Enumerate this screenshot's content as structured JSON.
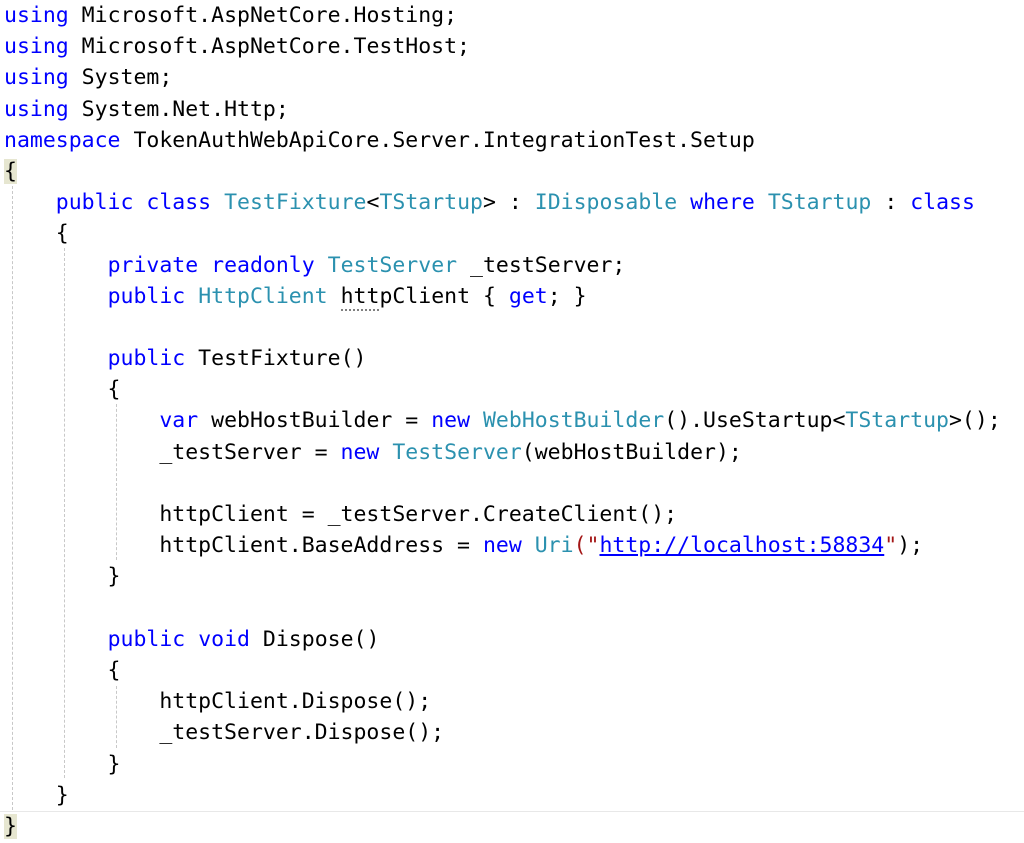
{
  "editor": {
    "language": "C#",
    "colors": {
      "keyword": "#0000ff",
      "type": "#2b91af",
      "identifier": "#000000",
      "string": "#a31515",
      "url": "#0000ff"
    },
    "lines": [
      [
        [
          "kw",
          "using"
        ],
        [
          "tx",
          " Microsoft.AspNetCore.Hosting;"
        ]
      ],
      [
        [
          "kw",
          "using"
        ],
        [
          "tx",
          " Microsoft.AspNetCore.TestHost;"
        ]
      ],
      [
        [
          "kw",
          "using"
        ],
        [
          "tx",
          " System;"
        ]
      ],
      [
        [
          "kw",
          "using"
        ],
        [
          "tx",
          " System.Net.Http;"
        ]
      ],
      [
        [
          "kw",
          "namespace"
        ],
        [
          "tx",
          " TokenAuthWebApiCore.Server.IntegrationTest.Setup"
        ]
      ],
      [
        [
          "brace",
          "{"
        ]
      ],
      [
        [
          "tx",
          "    "
        ],
        [
          "kw",
          "public"
        ],
        [
          "tx",
          " "
        ],
        [
          "kw",
          "class"
        ],
        [
          "tx",
          " "
        ],
        [
          "ty",
          "TestFixture"
        ],
        [
          "tx",
          "<"
        ],
        [
          "ty",
          "TStartup"
        ],
        [
          "tx",
          "> : "
        ],
        [
          "ty",
          "IDisposable"
        ],
        [
          "tx",
          " "
        ],
        [
          "kw",
          "where"
        ],
        [
          "tx",
          " "
        ],
        [
          "ty",
          "TStartup"
        ],
        [
          "tx",
          " : "
        ],
        [
          "kw",
          "class"
        ]
      ],
      [
        [
          "tx",
          "    {"
        ]
      ],
      [
        [
          "tx",
          "        "
        ],
        [
          "kw",
          "private"
        ],
        [
          "tx",
          " "
        ],
        [
          "kw",
          "readonly"
        ],
        [
          "tx",
          " "
        ],
        [
          "ty",
          "TestServer"
        ],
        [
          "tx",
          " _testServer;"
        ]
      ],
      [
        [
          "tx",
          "        "
        ],
        [
          "kw",
          "public"
        ],
        [
          "tx",
          " "
        ],
        [
          "ty",
          "HttpClient"
        ],
        [
          "tx",
          " "
        ],
        [
          "sq",
          "htt"
        ],
        [
          "tx",
          "pClient { "
        ],
        [
          "kw",
          "get"
        ],
        [
          "tx",
          "; }"
        ]
      ],
      [
        [
          "tx",
          ""
        ]
      ],
      [
        [
          "tx",
          "        "
        ],
        [
          "kw",
          "public"
        ],
        [
          "tx",
          " TestFixture()"
        ]
      ],
      [
        [
          "tx",
          "        {"
        ]
      ],
      [
        [
          "tx",
          "            "
        ],
        [
          "kw",
          "var"
        ],
        [
          "tx",
          " webHostBuilder = "
        ],
        [
          "kw",
          "new"
        ],
        [
          "tx",
          " "
        ],
        [
          "ty",
          "WebHostBuilder"
        ],
        [
          "tx",
          "().UseStartup<"
        ],
        [
          "ty",
          "TStartup"
        ],
        [
          "tx",
          ">();"
        ]
      ],
      [
        [
          "tx",
          "            _testServer = "
        ],
        [
          "kw",
          "new"
        ],
        [
          "tx",
          " "
        ],
        [
          "ty",
          "TestServer"
        ],
        [
          "tx",
          "(webHostBuilder);"
        ]
      ],
      [
        [
          "tx",
          ""
        ]
      ],
      [
        [
          "tx",
          "            httpClient = _testServer.CreateClient();"
        ]
      ],
      [
        [
          "tx",
          "            httpClient.BaseAddress = "
        ],
        [
          "kw",
          "new"
        ],
        [
          "tx",
          " "
        ],
        [
          "ty",
          "Uri"
        ],
        [
          "st",
          "(\""
        ],
        [
          "url",
          "http://localhost:58834"
        ],
        [
          "st",
          "\""
        ],
        [
          "tx",
          ");"
        ]
      ],
      [
        [
          "tx",
          "        }"
        ]
      ],
      [
        [
          "tx",
          ""
        ]
      ],
      [
        [
          "tx",
          "        "
        ],
        [
          "kw",
          "public"
        ],
        [
          "tx",
          " "
        ],
        [
          "kw",
          "void"
        ],
        [
          "tx",
          " Dispose()"
        ]
      ],
      [
        [
          "tx",
          "        {"
        ]
      ],
      [
        [
          "tx",
          "            httpClient.Dispose();"
        ]
      ],
      [
        [
          "tx",
          "            _testServer.Dispose();"
        ]
      ],
      [
        [
          "tx",
          "        }"
        ]
      ],
      [
        [
          "tx",
          "    }"
        ]
      ],
      [
        [
          "brace",
          "}"
        ]
      ]
    ]
  }
}
